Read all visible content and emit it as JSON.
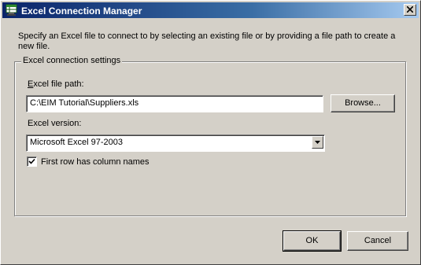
{
  "window": {
    "title": "Excel Connection Manager",
    "app_icon": "excel-connection-icon",
    "close_icon": "close-icon"
  },
  "description": "Specify an Excel file to connect to by selecting an existing file or by providing a file path to create a new file.",
  "settings": {
    "group_label": "Excel connection settings",
    "file_path_label": "Excel file path:",
    "file_path_value": "C:\\EIM Tutorial\\Suppliers.xls",
    "browse_label": "Browse...",
    "version_label": "Excel version:",
    "version_value": "Microsoft Excel 97-2003",
    "first_row_label": "First row has column names",
    "first_row_checked": true
  },
  "buttons": {
    "ok": "OK",
    "cancel": "Cancel"
  }
}
